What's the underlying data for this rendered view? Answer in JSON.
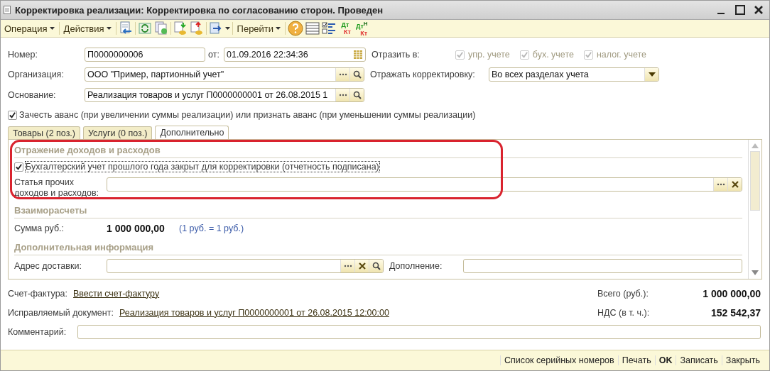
{
  "window": {
    "title": "Корректировка реализации: Корректировка по согласованию сторон. Проведен"
  },
  "toolbar": {
    "menus": [
      "Операция",
      "Действия",
      "Перейти"
    ],
    "ledger_buttons": [
      {
        "debit": "Дт",
        "credit": "Кт"
      },
      {
        "debit": "Дт",
        "mark": "Н",
        "credit": "Кт"
      }
    ]
  },
  "header": {
    "number": {
      "label": "Номер:",
      "value": "П0000000006"
    },
    "date": {
      "label": "от:",
      "value": "01.09.2016 22:34:36"
    },
    "reflect_in": {
      "label": "Отразить в:",
      "options": [
        {
          "label": "упр. учете",
          "checked": true,
          "disabled": true
        },
        {
          "label": "бух. учете",
          "checked": true,
          "disabled": true
        },
        {
          "label": "налог. учете",
          "checked": true,
          "disabled": true
        }
      ]
    },
    "organization": {
      "label": "Организация:",
      "value": "ООО \"Пример, партионный учет\""
    },
    "reflect_correction": {
      "label": "Отражать корректировку:",
      "value": "Во всех разделах учета"
    },
    "basis": {
      "label": "Основание:",
      "value": "Реализация товаров и услуг П0000000001 от 26.08.2015 1"
    },
    "advance": {
      "label": "Зачесть аванс (при увеличении суммы реализации) или признать аванс (при уменьшении суммы реализации)",
      "checked": true
    }
  },
  "tabs": [
    {
      "label": "Товары (2 поз.)",
      "selected": false
    },
    {
      "label": "Услуги (0 поз.)",
      "selected": false
    },
    {
      "label": "Дополнительно",
      "selected": true
    }
  ],
  "panel": {
    "income_section": {
      "title": "Отражение доходов и расходов",
      "highlighted": true,
      "closed_year": {
        "label": "Бухгалтерский учет прошлого года закрыт для корректировки (отчетность подписана)",
        "checked": true
      },
      "item_field": {
        "label": "Статья прочих доходов и расходов:"
      }
    },
    "settlements": {
      "title": "Взаиморасчеты",
      "label": "Сумма руб.:",
      "amount": "1 000 000,00",
      "rate": "(1 руб. = 1 руб.)"
    },
    "extra": {
      "title": "Дополнительная информация",
      "address": {
        "label": "Адрес доставки:"
      },
      "addition": {
        "label": "Дополнение:"
      }
    }
  },
  "footer_fields": {
    "invoice": {
      "label": "Счет-фактура:",
      "link": "Ввести счет-фактуру"
    },
    "corrected": {
      "label": "Исправляемый документ:",
      "link": "Реализация товаров и услуг П0000000001 от 26.08.2015 12:00:00"
    },
    "total": {
      "label": "Всего (руб.):",
      "value": "1 000 000,00"
    },
    "vat": {
      "label": "НДС (в т. ч.):",
      "value": "152 542,37"
    },
    "comment": {
      "label": "Комментарий:"
    }
  },
  "buttons": [
    {
      "label": "Список серийных номеров",
      "default": false
    },
    {
      "label": "Печать",
      "default": false
    },
    {
      "label": "OK",
      "default": true
    },
    {
      "label": "Записать",
      "default": false
    },
    {
      "label": "Закрыть",
      "default": false
    }
  ]
}
